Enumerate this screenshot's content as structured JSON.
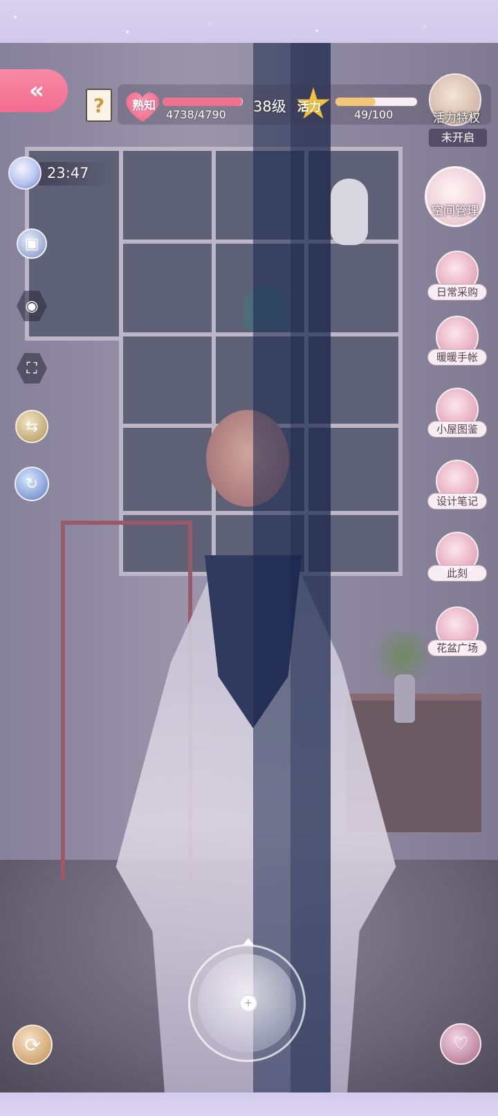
{
  "top_bar": {
    "back_symbol": "«",
    "help_symbol": "?",
    "intimacy": {
      "badge_label": "熟知",
      "current": 4738,
      "max": 4790,
      "text": "4738/4790",
      "color": "#f0708f"
    },
    "level_text": "38级",
    "vitality": {
      "badge_label": "活力",
      "current": 49,
      "max": 100,
      "text": "49/100",
      "color": "#f2c878"
    },
    "vip": {
      "label": "活力特权",
      "status": "未开启"
    }
  },
  "time": {
    "text": "23:47"
  },
  "left_icons": [
    {
      "name": "bag-icon",
      "glyph": "▣"
    },
    {
      "name": "camera-icon",
      "glyph": "◉"
    },
    {
      "name": "fullscreen-icon",
      "glyph": "⛶"
    },
    {
      "name": "record-icon",
      "glyph": "⇆"
    },
    {
      "name": "rotate-view-icon",
      "glyph": "↻"
    }
  ],
  "right_menu": {
    "space_label": "空间管理",
    "items": [
      {
        "label": "日常采购"
      },
      {
        "label": "暖暖手帐"
      },
      {
        "label": "小屋图鉴"
      },
      {
        "label": "设计笔记"
      },
      {
        "label": "此刻"
      },
      {
        "label": "花盆广场"
      }
    ]
  },
  "bottom": {
    "reset_symbol": "⟳",
    "joystick_symbol": "+",
    "social_symbol": "♡"
  }
}
